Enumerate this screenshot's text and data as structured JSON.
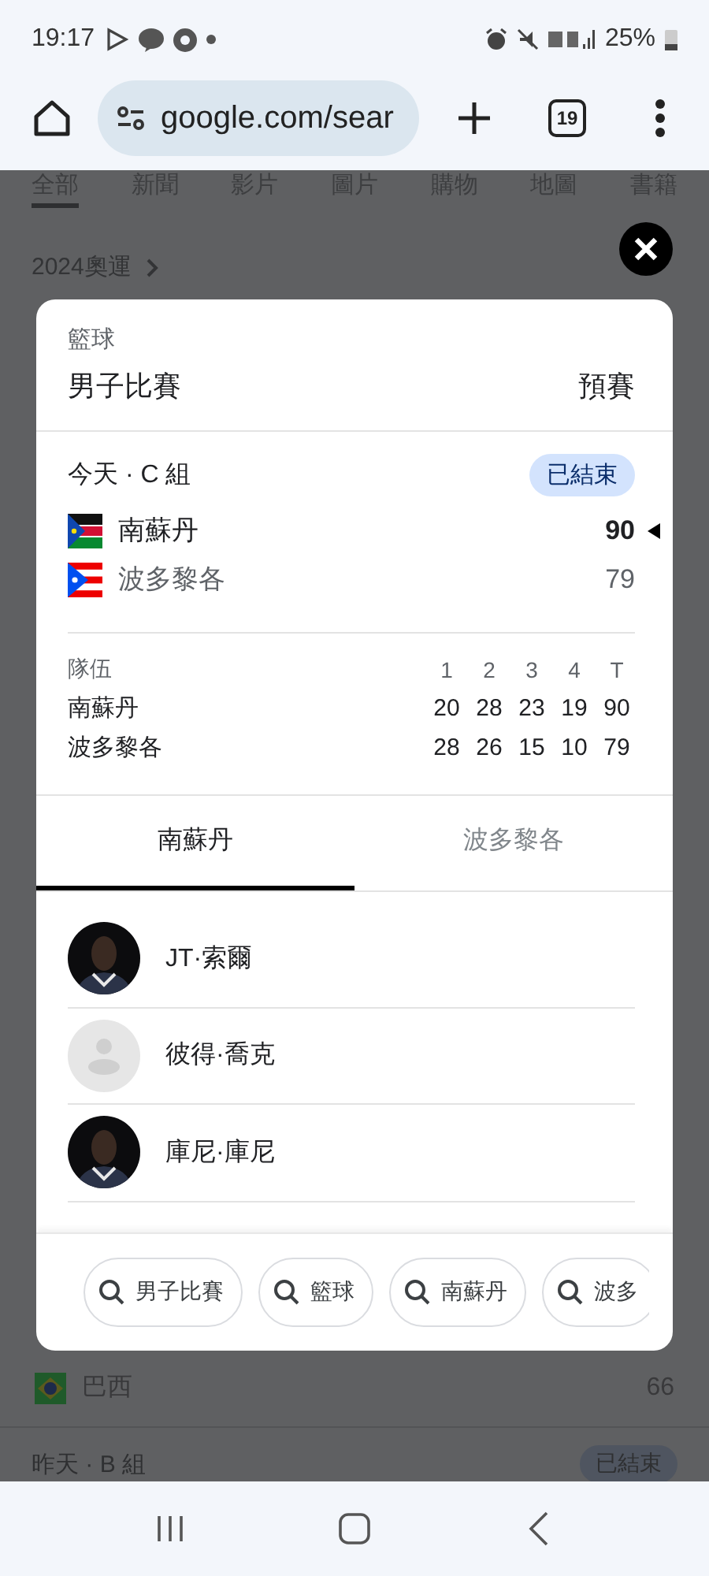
{
  "status_bar": {
    "time": "19:17",
    "battery": "25%"
  },
  "browser": {
    "url": "google.com/sear",
    "tab_count": "19"
  },
  "background": {
    "tabs": [
      {
        "label": "全部",
        "selected": true
      },
      {
        "label": "新聞",
        "selected": false
      },
      {
        "label": "影片",
        "selected": false
      },
      {
        "label": "圖片",
        "selected": false
      },
      {
        "label": "購物",
        "selected": false
      },
      {
        "label": "地圖",
        "selected": false
      },
      {
        "label": "書籍",
        "selected": false
      }
    ],
    "breadcrumb": "2024奧運",
    "team": {
      "name": "巴西",
      "score": "66"
    },
    "next_game": {
      "label": "昨天 · B 組",
      "status": "已結束"
    }
  },
  "card": {
    "sport": "籃球",
    "event": "男子比賽",
    "round": "預賽",
    "game_label": "今天 · C 組",
    "status": "已結束",
    "teams": [
      {
        "name": "南蘇丹",
        "score": "90",
        "winner": true
      },
      {
        "name": "波多黎各",
        "score": "79",
        "winner": false
      }
    ],
    "linescore": {
      "columns": [
        "隊伍",
        "1",
        "2",
        "3",
        "4",
        "T"
      ],
      "rows": [
        [
          "南蘇丹",
          "20",
          "28",
          "23",
          "19",
          "90"
        ],
        [
          "波多黎各",
          "28",
          "26",
          "15",
          "10",
          "79"
        ]
      ]
    },
    "tabs": [
      {
        "label": "南蘇丹",
        "selected": true
      },
      {
        "label": "波多黎各",
        "selected": false
      }
    ],
    "players": [
      {
        "name": "JT·索爾"
      },
      {
        "name": "彼得·喬克",
        "kind": "placeholder"
      },
      {
        "name": "庫尼·庫尼"
      }
    ],
    "chips": [
      "男子比賽",
      "籃球",
      "南蘇丹",
      "波多"
    ]
  }
}
